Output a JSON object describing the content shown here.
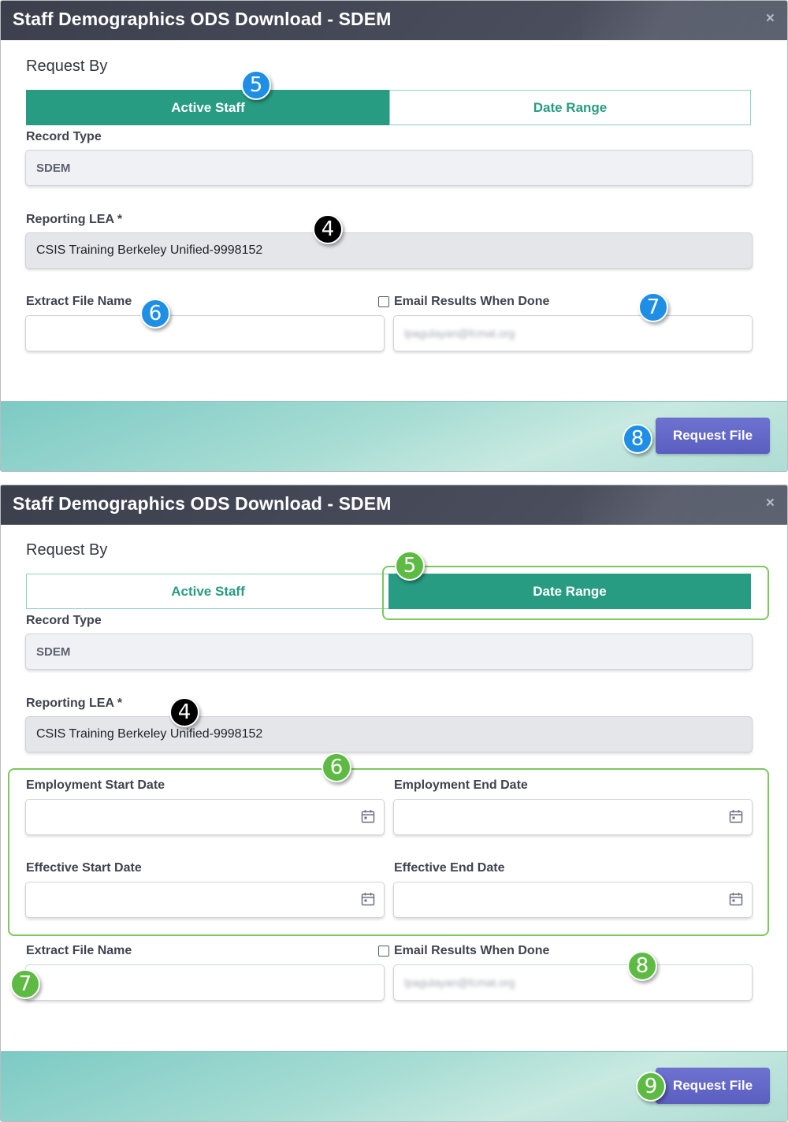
{
  "dialog_title": "Staff Demographics ODS Download - SDEM",
  "close_label": "×",
  "request_by_label": "Request By",
  "tabs": {
    "active_staff": "Active Staff",
    "date_range": "Date Range"
  },
  "record_type": {
    "label": "Record Type",
    "value": "SDEM"
  },
  "reporting_lea": {
    "label": "Reporting LEA *",
    "value": "CSIS Training Berkeley Unified-9998152"
  },
  "extract_file_name": {
    "label": "Extract File Name",
    "value": ""
  },
  "email_results": {
    "label": "Email Results When Done",
    "checked": false,
    "value": "lpagulayan@fcmat.org"
  },
  "dates": {
    "employment_start": "Employment Start Date",
    "employment_end": "Employment End Date",
    "effective_start": "Effective Start Date",
    "effective_end": "Effective End Date"
  },
  "request_button": "Request File",
  "callouts_top": [
    "5",
    "4",
    "6",
    "7",
    "8"
  ],
  "callouts_bottom": [
    "5",
    "4",
    "6",
    "7",
    "8",
    "9"
  ],
  "colors": {
    "accent_teal": "#289c82",
    "button_purple": "#6366c8",
    "callout_blue": "#1f8fe6",
    "callout_green": "#5dbb43",
    "callout_black": "#000000"
  },
  "icons": {
    "calendar": "calendar-icon",
    "close": "close-icon"
  }
}
